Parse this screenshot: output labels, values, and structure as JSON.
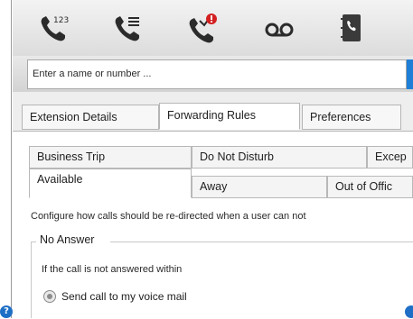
{
  "toolbar": {
    "buttons": [
      {
        "icon": "call-log-icon",
        "badge": "123"
      },
      {
        "icon": "phone-list-icon"
      },
      {
        "icon": "missed-call-icon"
      },
      {
        "icon": "voicemail-icon"
      },
      {
        "icon": "contacts-book-icon"
      }
    ]
  },
  "search": {
    "placeholder": "Enter a name or number ..."
  },
  "tabs": [
    {
      "label": "Extension Details",
      "active": false
    },
    {
      "label": "Forwarding Rules",
      "active": true
    },
    {
      "label": "Preferences",
      "active": false
    }
  ],
  "status_tabs": {
    "row1": [
      "Business Trip",
      "Do Not Disturb",
      "Excep"
    ],
    "row2": [
      "Available",
      "Away",
      "Out of Offic"
    ],
    "selected": "Available"
  },
  "forwarding": {
    "description": "Configure how calls should be re-directed when a user can not",
    "group_title": "No Answer",
    "condition": "If the call is not answered within",
    "option_label": "Send call to my voice mail"
  },
  "colors": {
    "accent": "#1f7fd6",
    "missed_badge": "#d32020"
  }
}
